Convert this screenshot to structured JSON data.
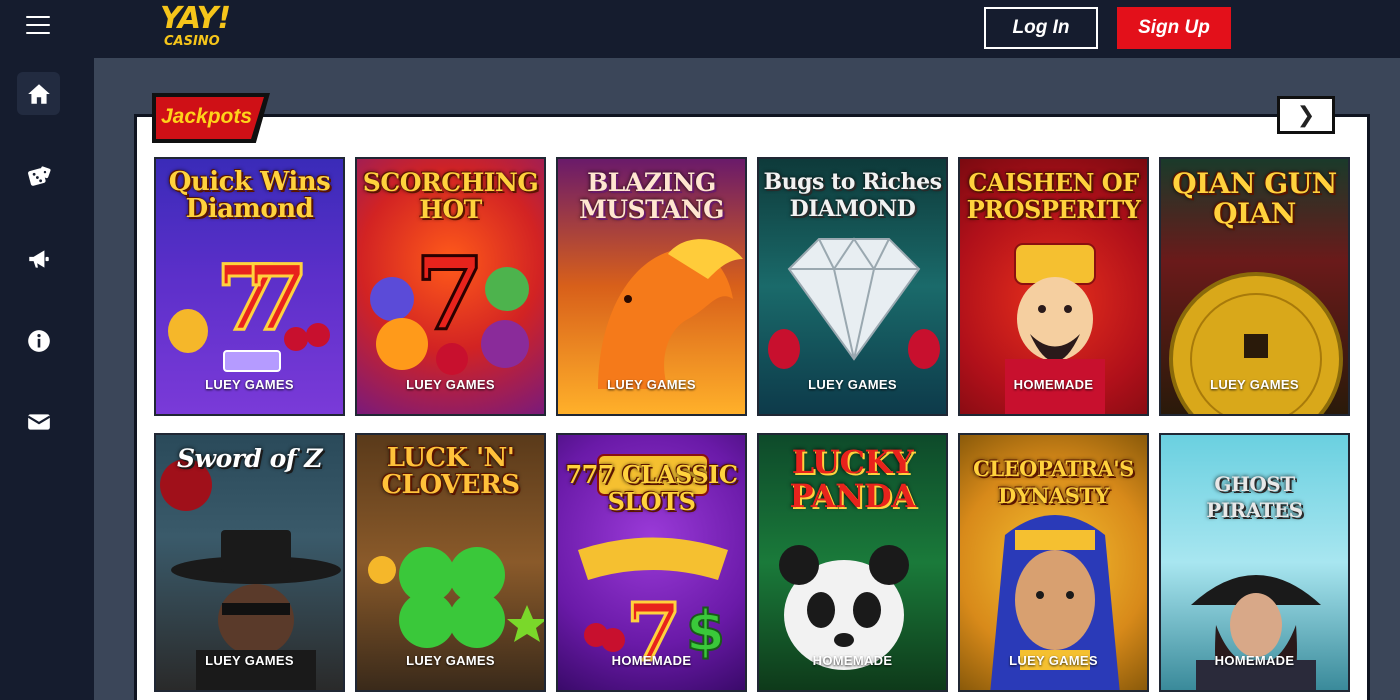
{
  "header": {
    "logo_top": "YAY!",
    "logo_bottom": "CASINO",
    "login_label": "Log In",
    "signup_label": "Sign Up"
  },
  "sidebar": {
    "items": [
      {
        "name": "home",
        "icon": "home-icon",
        "active": true
      },
      {
        "name": "games",
        "icon": "dice-icon",
        "active": false
      },
      {
        "name": "promotions",
        "icon": "megaphone-icon",
        "active": false
      },
      {
        "name": "info",
        "icon": "info-icon",
        "active": false
      },
      {
        "name": "contact",
        "icon": "mail-icon",
        "active": false
      }
    ]
  },
  "section": {
    "title": "Jackpots",
    "next_glyph": "❯"
  },
  "games": [
    {
      "title": "Quick Wins Diamond",
      "provider": "LUEY GAMES"
    },
    {
      "title": "SCORCHING HOT",
      "provider": "LUEY GAMES"
    },
    {
      "title": "BLAZING MUSTANG",
      "provider": "LUEY GAMES"
    },
    {
      "title": "Bugs to Riches DIAMOND",
      "provider": "LUEY GAMES"
    },
    {
      "title": "CAISHEN OF PROSPERITY",
      "provider": "HOMEMADE"
    },
    {
      "title": "QIAN GUN QIAN",
      "provider": "LUEY GAMES"
    },
    {
      "title": "Sword of Z",
      "provider": "LUEY GAMES"
    },
    {
      "title": "LUCK 'N' CLOVERS",
      "provider": "LUEY GAMES"
    },
    {
      "title": "777 CLASSIC SLOTS",
      "provider": "HOMEMADE"
    },
    {
      "title": "LUCKY PANDA",
      "provider": "HOMEMADE"
    },
    {
      "title": "CLEOPATRA'S DYNASTY",
      "provider": "LUEY GAMES"
    },
    {
      "title": "GHOST PIRATES",
      "provider": "HOMEMADE"
    }
  ],
  "colors": {
    "background": "#3b4659",
    "topbar": "#151c2e",
    "accent_red": "#e3101a",
    "logo_yellow": "#f6c51a"
  }
}
